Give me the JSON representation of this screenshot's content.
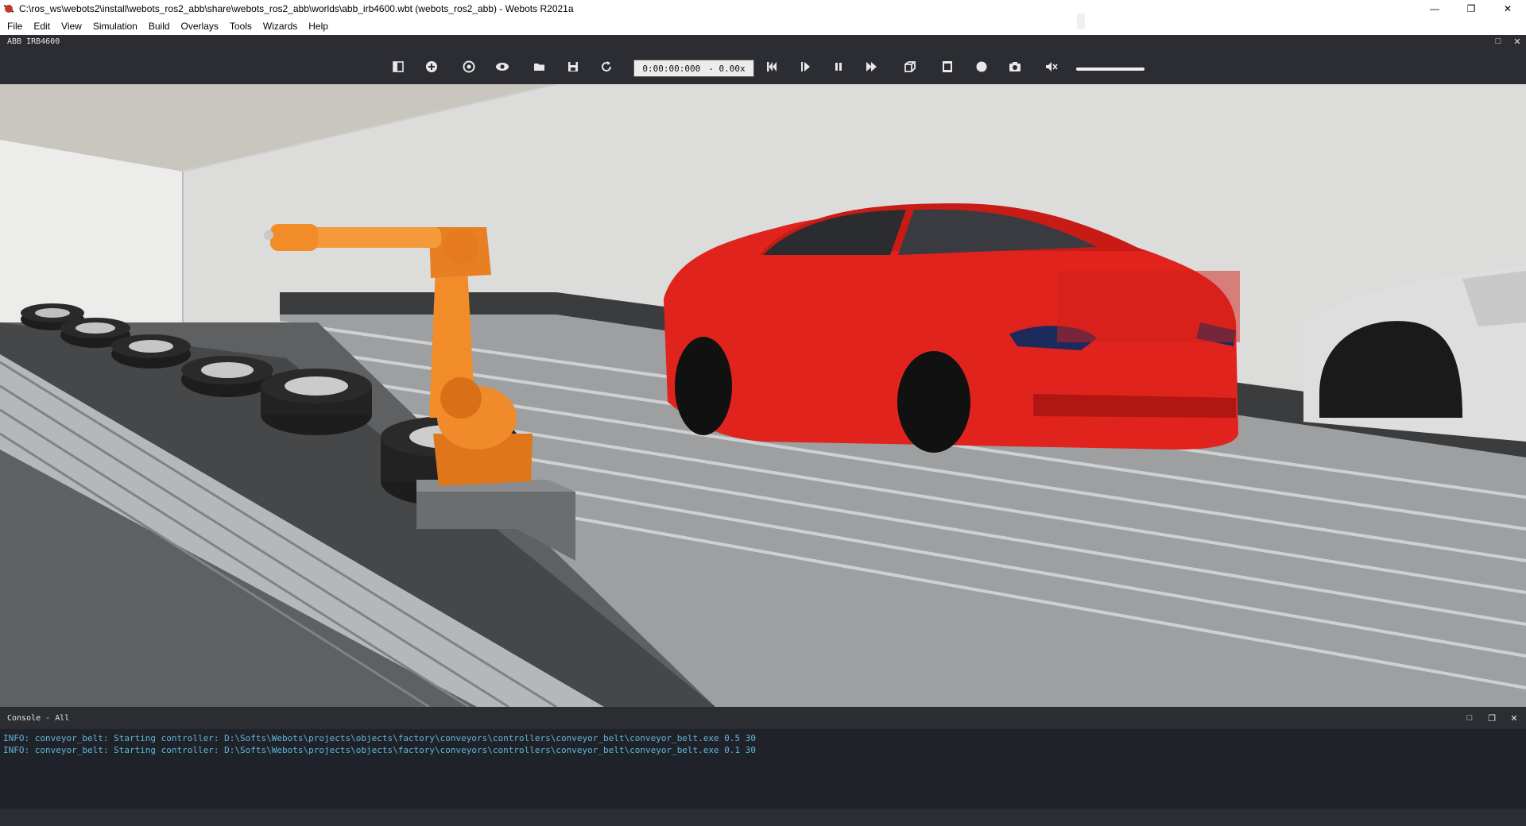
{
  "window": {
    "title": "C:\\ros_ws\\webots2\\install\\webots_ros2_abb\\share\\webots_ros2_abb\\worlds\\abb_irb4600.wbt (webots_ros2_abb) - Webots R2021a",
    "controls": {
      "minimize": "—",
      "restore": "❐",
      "close": "✕"
    }
  },
  "menu": {
    "items": [
      "File",
      "Edit",
      "View",
      "Simulation",
      "Build",
      "Overlays",
      "Tools",
      "Wizards",
      "Help"
    ]
  },
  "view_dock": {
    "title": "ABB IRB4600",
    "float_icon": "□",
    "close_icon": "✕"
  },
  "toolbar": {
    "time": "0:00:00:000",
    "speed": "- 0.00x",
    "icons": [
      "toggle-scene-tree-icon",
      "add-node-icon",
      "restore-viewpoint-icon",
      "view-icon",
      "open-world-icon",
      "save-world-icon",
      "reload-world-icon",
      "reset-simulation-icon",
      "step-icon",
      "pause-icon",
      "fast-forward-icon",
      "toggle-rendering-icon",
      "movie-icon",
      "record-icon",
      "screenshot-icon",
      "mute-icon"
    ]
  },
  "console": {
    "title": "Console - All",
    "lines": [
      "INFO: conveyor_belt: Starting controller: D:\\Softs\\Webots\\projects\\objects\\factory\\conveyors\\controllers\\conveyor_belt\\conveyor_belt.exe 0.5 30",
      "INFO: conveyor_belt: Starting controller: D:\\Softs\\Webots\\projects\\objects\\factory\\conveyors\\controllers\\conveyor_belt\\conveyor_belt.exe 0.1 30"
    ],
    "controls": {
      "restore": "□",
      "float": "❐",
      "close": "✕"
    }
  },
  "colors": {
    "dark_panel": "#2b2d33",
    "console_bg": "#20222a",
    "console_text": "#5fb6d6",
    "robot_orange": "#f28c28",
    "car_red": "#e0231d"
  }
}
